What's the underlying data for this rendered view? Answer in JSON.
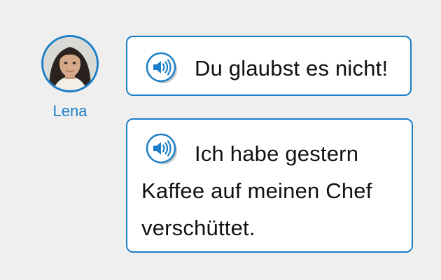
{
  "speaker": {
    "name": "Lena",
    "avatar_icon": "person-avatar",
    "accent_color": "#1b7fc7"
  },
  "messages": [
    {
      "text": "Du glaubst es nicht!",
      "icon": "speaker-audio-icon"
    },
    {
      "text": "Ich habe gestern Kaffee auf meinen Chef verschüttet.",
      "icon": "speaker-audio-icon"
    }
  ]
}
